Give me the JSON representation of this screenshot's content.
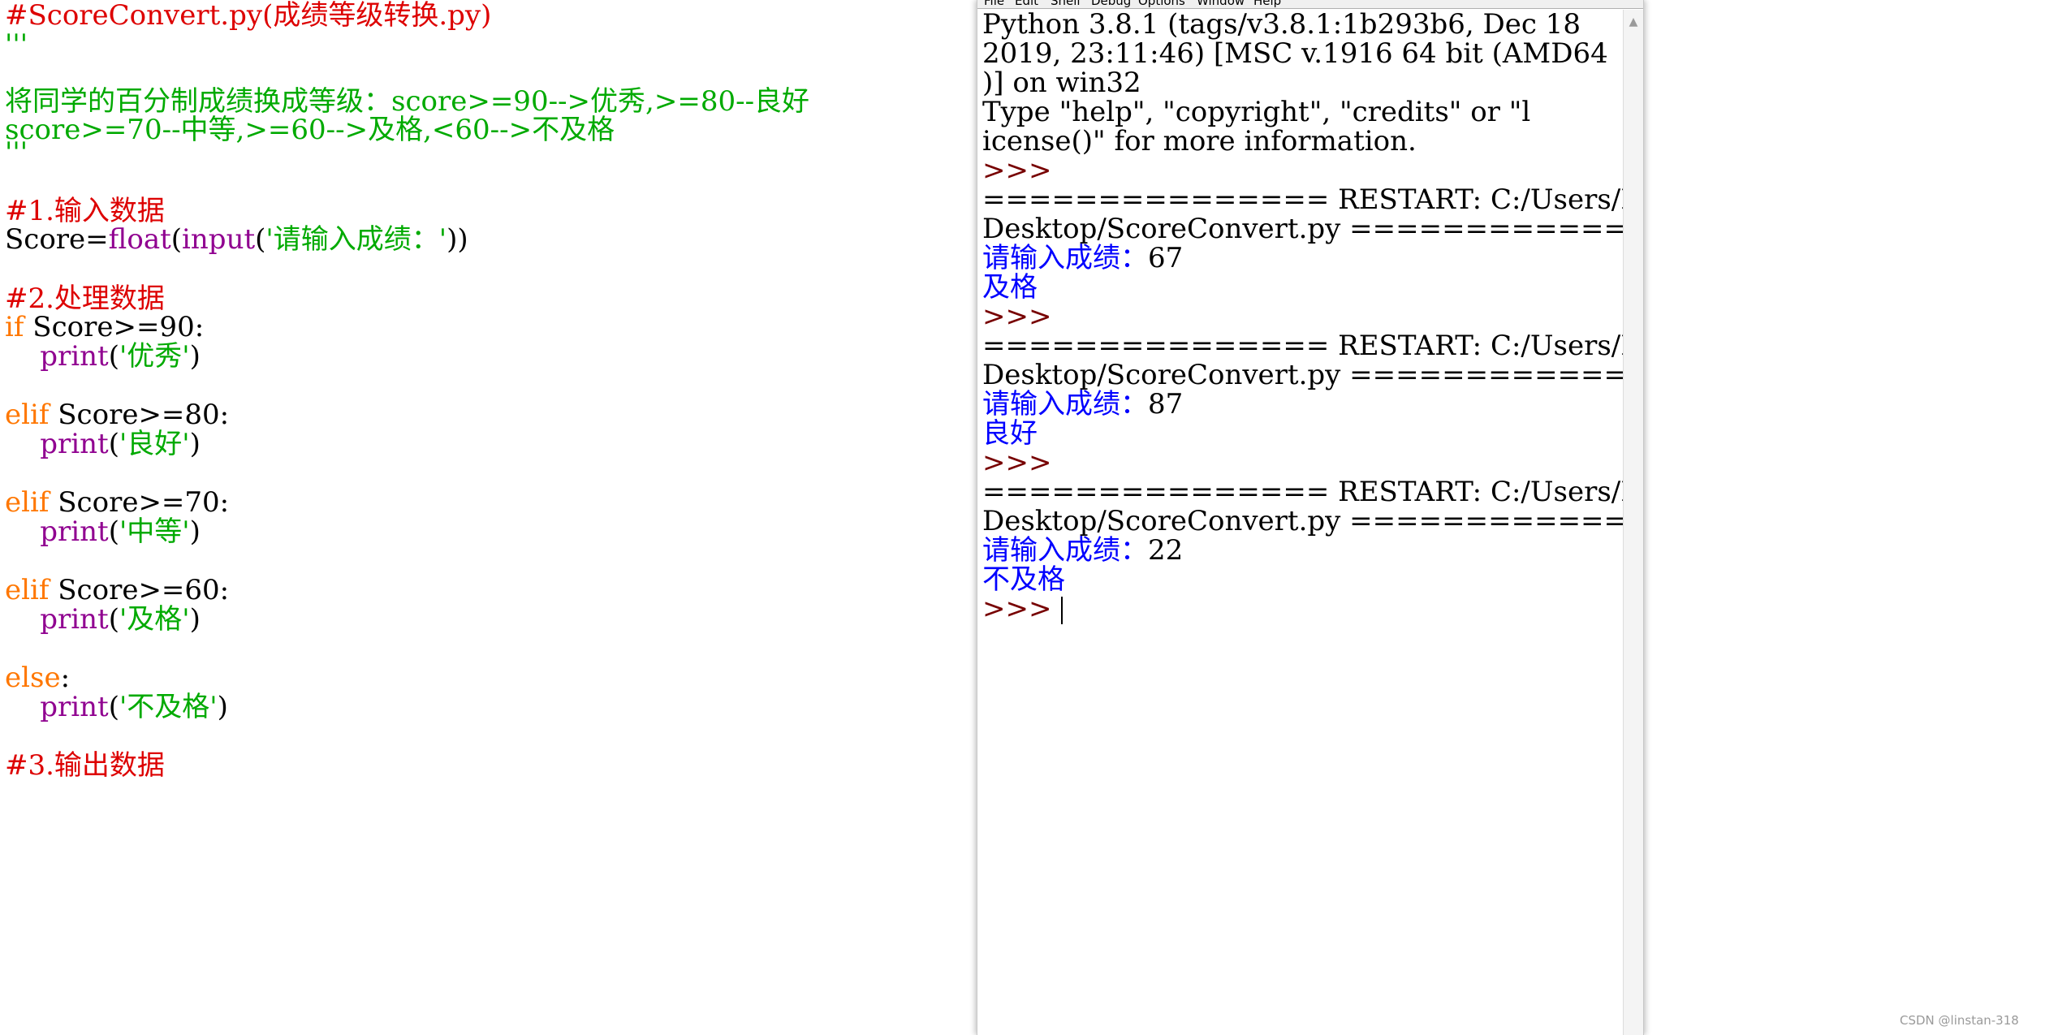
{
  "editor": {
    "lines": [
      {
        "segments": [
          {
            "t": "#ScoreConvert.py(成绩等级转换.py)",
            "c": "comment"
          }
        ]
      },
      {
        "segments": [
          {
            "t": "'''",
            "c": "string"
          }
        ]
      },
      {
        "segments": [
          {
            "t": "将同学的百分制成绩换成等级：score>=90-->优秀,>=80--良好",
            "c": "string"
          }
        ]
      },
      {
        "segments": [
          {
            "t": "score>=70--中等,>=60-->及格,<60-->不及格",
            "c": "string"
          }
        ]
      },
      {
        "segments": [
          {
            "t": "'''",
            "c": "string"
          }
        ]
      },
      {
        "segments": [
          {
            "t": "#1.输入数据",
            "c": "comment"
          }
        ]
      },
      {
        "segments": [
          {
            "t": "Score=",
            "c": "plain"
          },
          {
            "t": "float",
            "c": "builtin"
          },
          {
            "t": "(",
            "c": "plain"
          },
          {
            "t": "input",
            "c": "builtin"
          },
          {
            "t": "(",
            "c": "plain"
          },
          {
            "t": "'请输入成绩：'",
            "c": "string"
          },
          {
            "t": "))",
            "c": "plain"
          }
        ]
      },
      {
        "segments": [
          {
            "t": "#2.处理数据",
            "c": "comment"
          }
        ]
      },
      {
        "segments": [
          {
            "t": "if",
            "c": "keyword"
          },
          {
            "t": " Score>=90:",
            "c": "plain"
          }
        ]
      },
      {
        "segments": [
          {
            "t": "    ",
            "c": "plain"
          },
          {
            "t": "print",
            "c": "builtin"
          },
          {
            "t": "(",
            "c": "plain"
          },
          {
            "t": "'优秀'",
            "c": "string"
          },
          {
            "t": ")",
            "c": "plain"
          }
        ]
      },
      {
        "segments": [
          {
            "t": "elif",
            "c": "keyword"
          },
          {
            "t": " Score>=80:",
            "c": "plain"
          }
        ]
      },
      {
        "segments": [
          {
            "t": "    ",
            "c": "plain"
          },
          {
            "t": "print",
            "c": "builtin"
          },
          {
            "t": "(",
            "c": "plain"
          },
          {
            "t": "'良好'",
            "c": "string"
          },
          {
            "t": ")",
            "c": "plain"
          }
        ]
      },
      {
        "segments": [
          {
            "t": "elif",
            "c": "keyword"
          },
          {
            "t": " Score>=70:",
            "c": "plain"
          }
        ]
      },
      {
        "segments": [
          {
            "t": "    ",
            "c": "plain"
          },
          {
            "t": "print",
            "c": "builtin"
          },
          {
            "t": "(",
            "c": "plain"
          },
          {
            "t": "'中等'",
            "c": "string"
          },
          {
            "t": ")",
            "c": "plain"
          }
        ]
      },
      {
        "segments": [
          {
            "t": "elif",
            "c": "keyword"
          },
          {
            "t": " Score>=60:",
            "c": "plain"
          }
        ]
      },
      {
        "segments": [
          {
            "t": "    ",
            "c": "plain"
          },
          {
            "t": "print",
            "c": "builtin"
          },
          {
            "t": "(",
            "c": "plain"
          },
          {
            "t": "'及格'",
            "c": "string"
          },
          {
            "t": ")",
            "c": "plain"
          }
        ]
      },
      {
        "segments": [
          {
            "t": "else",
            "c": "keyword"
          },
          {
            "t": ":",
            "c": "plain"
          }
        ]
      },
      {
        "segments": [
          {
            "t": "    ",
            "c": "plain"
          },
          {
            "t": "print",
            "c": "builtin"
          },
          {
            "t": "(",
            "c": "plain"
          },
          {
            "t": "'不及格'",
            "c": "string"
          },
          {
            "t": ")",
            "c": "plain"
          }
        ]
      },
      {
        "segments": [
          {
            "t": "#3.输出数据",
            "c": "comment"
          }
        ]
      }
    ]
  },
  "shell": {
    "menu": [
      "File",
      "Edit",
      "Shell",
      "Debug",
      "Options",
      "Window",
      "Help"
    ],
    "lines": [
      {
        "segments": [
          {
            "t": "Python 3.8.1 (tags/v3.8.1:1b293b6, Dec 18",
            "c": "plain"
          }
        ]
      },
      {
        "segments": [
          {
            "t": "2019, 23:11:46) [MSC v.1916 64 bit (AMD64",
            "c": "plain"
          }
        ]
      },
      {
        "segments": [
          {
            "t": ")] on win32",
            "c": "plain"
          }
        ]
      },
      {
        "segments": [
          {
            "t": "Type \"help\", \"copyright\", \"credits\" or \"l",
            "c": "plain"
          }
        ]
      },
      {
        "segments": [
          {
            "t": "icense()\" for more information.",
            "c": "plain"
          }
        ]
      },
      {
        "segments": [
          {
            "t": ">>>",
            "c": "prompt"
          }
        ]
      },
      {
        "segments": [
          {
            "t": "=============== RESTART: C:/Users/LENOVO/",
            "c": "plain"
          }
        ]
      },
      {
        "segments": [
          {
            "t": "Desktop/ScoreConvert.py ===============",
            "c": "plain"
          }
        ]
      },
      {
        "segments": [
          {
            "t": "请输入成绩：",
            "c": "output"
          },
          {
            "t": "67",
            "c": "plain"
          }
        ]
      },
      {
        "segments": [
          {
            "t": "及格",
            "c": "output"
          }
        ]
      },
      {
        "segments": [
          {
            "t": ">>>",
            "c": "prompt"
          }
        ]
      },
      {
        "segments": [
          {
            "t": "=============== RESTART: C:/Users/LENOVO/",
            "c": "plain"
          }
        ]
      },
      {
        "segments": [
          {
            "t": "Desktop/ScoreConvert.py ===============",
            "c": "plain"
          }
        ]
      },
      {
        "segments": [
          {
            "t": "请输入成绩：",
            "c": "output"
          },
          {
            "t": "87",
            "c": "plain"
          }
        ]
      },
      {
        "segments": [
          {
            "t": "良好",
            "c": "output"
          }
        ]
      },
      {
        "segments": [
          {
            "t": ">>>",
            "c": "prompt"
          }
        ]
      },
      {
        "segments": [
          {
            "t": "=============== RESTART: C:/Users/LENOVO/",
            "c": "plain"
          }
        ]
      },
      {
        "segments": [
          {
            "t": "Desktop/ScoreConvert.py ===============",
            "c": "plain"
          }
        ]
      },
      {
        "segments": [
          {
            "t": "请输入成绩：",
            "c": "output"
          },
          {
            "t": "22",
            "c": "plain"
          }
        ]
      },
      {
        "segments": [
          {
            "t": "不及格",
            "c": "output"
          }
        ]
      },
      {
        "segments": [
          {
            "t": ">>>",
            "c": "prompt"
          }
        ],
        "cursor": true
      }
    ],
    "scroll_up_glyph": "▲"
  },
  "watermark": "CSDN @linstan-318",
  "colors": {
    "comment": "#dd0000",
    "keyword": "#ff7700",
    "builtin": "#900090",
    "string": "#00aa00",
    "plain": "#000000",
    "shell_prompt": "#770000",
    "shell_output": "#0000ff"
  }
}
